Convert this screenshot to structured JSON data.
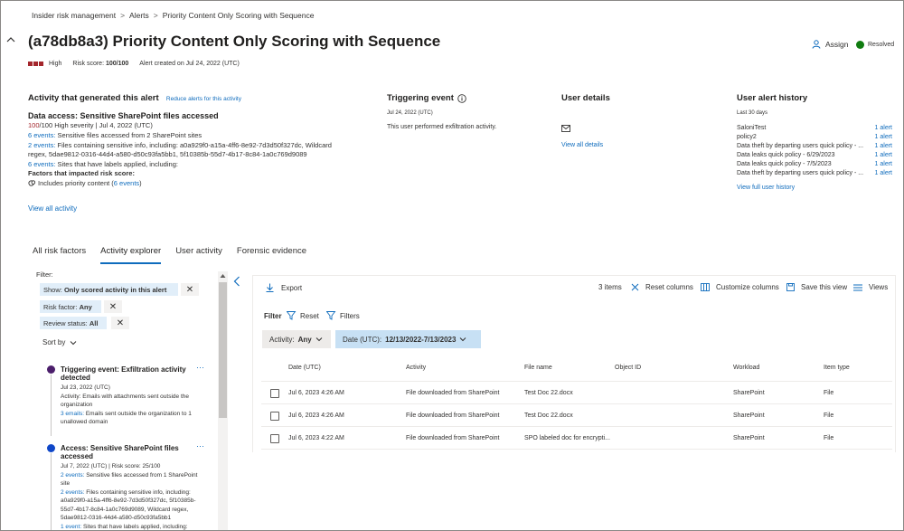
{
  "breadcrumb": [
    "Insider risk management",
    "Alerts",
    "Priority Content Only Scoring with Sequence"
  ],
  "title": "(a78db8a3) Priority Content Only Scoring with Sequence",
  "meta": {
    "severity": "High",
    "risk_score_label": "Risk score:",
    "risk_score": "100/100",
    "created": "Alert created on Jul 24, 2022 (UTC)"
  },
  "actions": {
    "assign": "Assign",
    "status": "Resolved"
  },
  "colors": {
    "accent": "#0f6cbd",
    "severity_red": "#a4262c",
    "resolved_green": "#107c10",
    "chip_blue": "#c7e0f4",
    "purple_dot": "#4b1e6b",
    "blue_dot": "#0f47c8"
  },
  "activity": {
    "heading": "Activity that generated this alert",
    "reduce_link": "Reduce alerts for this activity",
    "subtitle": "Data access: Sensitive SharePoint files accessed",
    "score": "100",
    "score_rest": "/100 High severity | Jul 4, 2022 (UTC)",
    "lines": [
      {
        "link": "6 events:",
        "text": " Sensitive files accessed from 2 SharePoint sites"
      },
      {
        "link": "2 events:",
        "text": " Files containing sensitive info, including: a0a929f0-a15a-4ff6-8e92-7d3d50f327dc, Wildcard"
      },
      {
        "link": "",
        "text": "regex, 5dae9812-0316-44d4-a580-d50c93fa5bb1, 5f10385b-55d7-4b17-8c84-1a0c769d9089"
      },
      {
        "link": "6 events:",
        "text": " Sites that have labels applied, including:"
      }
    ],
    "factors_heading": "Factors that impacted risk score:",
    "factor_text": "Includes priority content (",
    "factor_link": "6 events",
    "factor_close": ")",
    "view_all": "View all activity"
  },
  "triggering": {
    "heading": "Triggering event",
    "date": "Jul 24, 2022 (UTC)",
    "text": "This user performed exfiltration activity."
  },
  "user_details": {
    "heading": "User details",
    "view_all": "View all details"
  },
  "history": {
    "heading": "User alert history",
    "range": "Last 30 days",
    "items": [
      {
        "name": "SaloniTest",
        "count": "1 alert"
      },
      {
        "name": "policy2",
        "count": "1 alert"
      },
      {
        "name": "Data theft by departing users quick policy - ...",
        "count": "1 alert"
      },
      {
        "name": "Data leaks quick policy - 6/29/2023",
        "count": "1 alert"
      },
      {
        "name": "Data leaks quick policy - 7/5/2023",
        "count": "1 alert"
      },
      {
        "name": "Data theft by departing users quick policy - ...",
        "count": "1 alert"
      }
    ],
    "view_full": "View full user history"
  },
  "tabs": [
    "All risk factors",
    "Activity explorer",
    "User activity",
    "Forensic evidence"
  ],
  "filter_panel": {
    "label": "Filter:",
    "pills": [
      {
        "label": "Show:",
        "value": "Only scored activity in this alert"
      },
      {
        "label": "Risk factor:",
        "value": "Any"
      },
      {
        "label": "Review status:",
        "value": "All"
      }
    ],
    "sort_by": "Sort by",
    "events": [
      {
        "title_lines": [
          "Triggering event: Exfiltration activity",
          "detected"
        ],
        "date": "Jul 23, 2022 (UTC)",
        "lines": [
          {
            "link": "",
            "text": "Activity: Emails with attachments sent outside the"
          },
          {
            "link": "",
            "text": "organization"
          },
          {
            "link": "3 emails:",
            "text": " Emails sent outside the organization to 1"
          },
          {
            "link": "",
            "text": "unallowed domain"
          }
        ]
      },
      {
        "title_lines": [
          "Access: Sensitive SharePoint files",
          "accessed"
        ],
        "date": "Jul 7, 2022 (UTC) | Risk score: 25/100",
        "lines": [
          {
            "link": "2 events:",
            "text": " Sensitive files accessed from 1 SharePoint"
          },
          {
            "link": "",
            "text": "site"
          },
          {
            "link": "2 events:",
            "text": " Files containing sensitive info, including:"
          },
          {
            "link": "",
            "text": "a0a929f0-a15a-4ff6-8e92-7d3d50f327dc, 5f10385b-"
          },
          {
            "link": "",
            "text": "55d7-4b17-8c84-1a0c769d9089, Wildcard regex,"
          },
          {
            "link": "",
            "text": "5dae9812-0316-44d4-a580-d50c93fa5bb1"
          },
          {
            "link": "1 event:",
            "text": " Sites that have labels applied, including:"
          }
        ]
      }
    ]
  },
  "explorer": {
    "export": "Export",
    "item_count": "3 items",
    "reset_columns": "Reset columns",
    "customize_columns": "Customize columns",
    "save_view": "Save this view",
    "views": "Views",
    "filter_label": "Filter",
    "reset": "Reset",
    "filters": "Filters",
    "activity_chip": {
      "label": "Activity:",
      "value": "Any"
    },
    "date_chip": {
      "label": "Date (UTC):",
      "value": "12/13/2022-7/13/2023"
    },
    "columns": [
      "Date (UTC)",
      "Activity",
      "File name",
      "Object ID",
      "Workload",
      "Item type"
    ],
    "rows": [
      [
        "Jul 6, 2023 4:26 AM",
        "File downloaded from SharePoint",
        "Test Doc 22.docx",
        "",
        "SharePoint",
        "File"
      ],
      [
        "Jul 6, 2023 4:26 AM",
        "File downloaded from SharePoint",
        "Test Doc 22.docx",
        "",
        "SharePoint",
        "File"
      ],
      [
        "Jul 6, 2023 4:22 AM",
        "File downloaded from SharePoint",
        "SPO labeled doc for encrypti...",
        "",
        "SharePoint",
        "File"
      ]
    ]
  }
}
